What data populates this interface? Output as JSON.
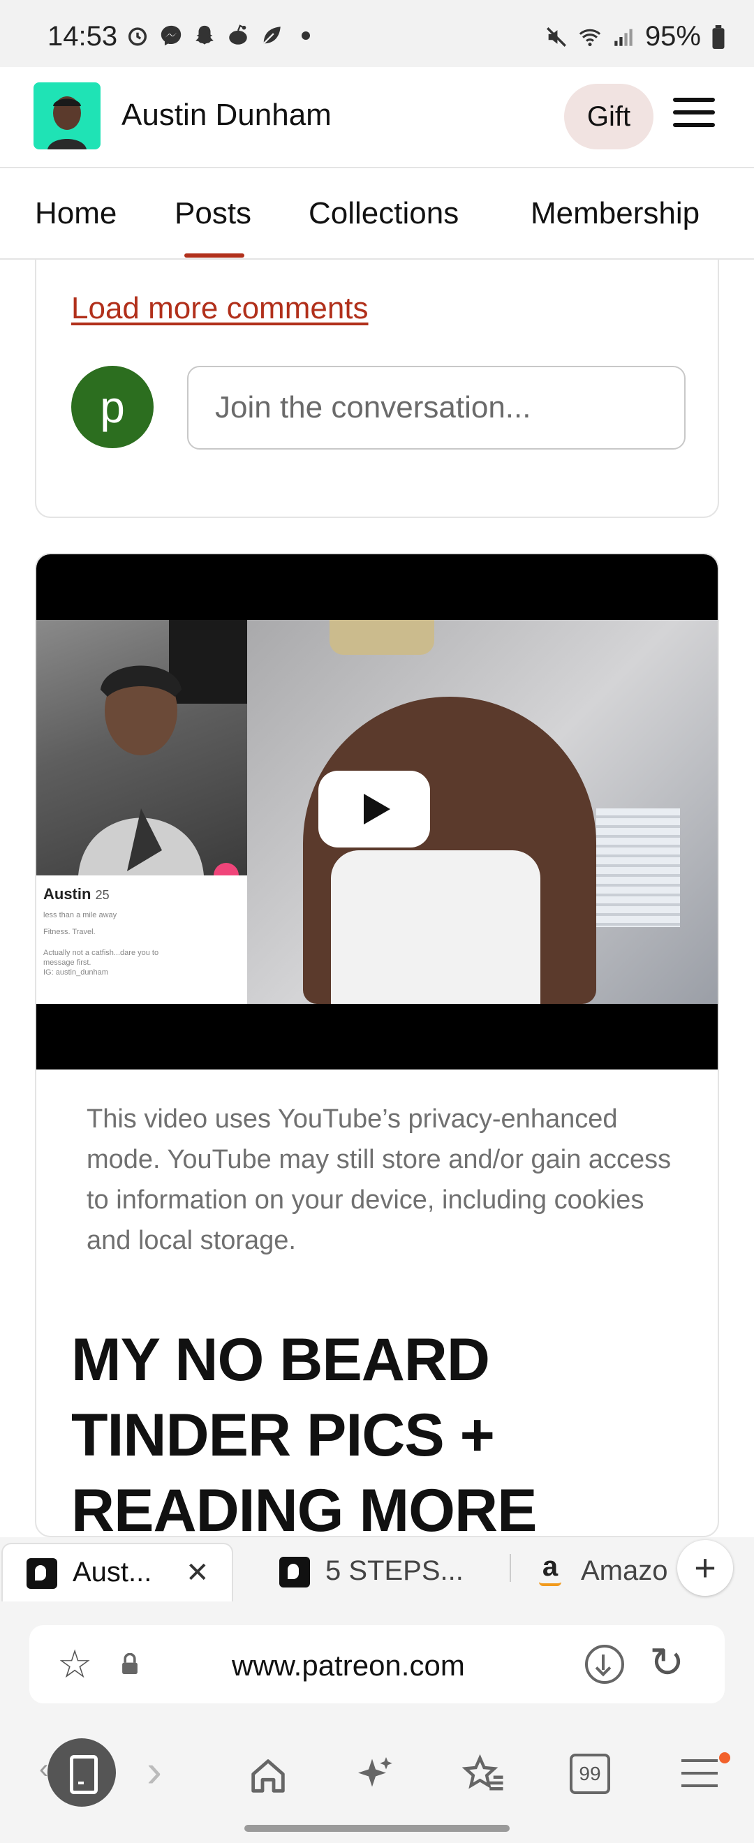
{
  "status_bar": {
    "time": "14:53",
    "battery": "95%"
  },
  "creator": {
    "name": "Austin Dunham",
    "gift_label": "Gift"
  },
  "nav_tabs": [
    {
      "label": "Home"
    },
    {
      "label": "Posts",
      "active": true
    },
    {
      "label": "Collections"
    },
    {
      "label": "Membership"
    }
  ],
  "comments": {
    "load_more_label": "Load more comments",
    "user_initial": "p",
    "input_placeholder": "Join the conversation..."
  },
  "post": {
    "video_thumbnail": {
      "profile_name": "Austin",
      "profile_age": "25",
      "profile_distance": "less than a mile away",
      "profile_interests": "Fitness. Travel.",
      "profile_bio_1": "Actually not a catfish...dare you to",
      "profile_bio_2": "message first.",
      "profile_bio_3": "IG: austin_dunham"
    },
    "privacy_notice": "This video uses YouTube’s privacy-enhanced mode. YouTube may still store and/or gain access to information on your device, including cookies and local storage.",
    "title": "MY NO BEARD TINDER PICS + READING MORE"
  },
  "browser": {
    "tabs": [
      {
        "label": "Aust...",
        "active": true
      },
      {
        "label": "5 STEPS..."
      },
      {
        "label": "Amazo"
      }
    ],
    "url": "www.patreon.com",
    "tabs_count": "99"
  },
  "colors": {
    "accent": "#b1301b",
    "gift_bg": "#f1e3e1",
    "creator_avatar_bg": "#1fe3b5",
    "user_avatar_bg": "#2c6e1f",
    "notification_dot": "#f2612b"
  }
}
